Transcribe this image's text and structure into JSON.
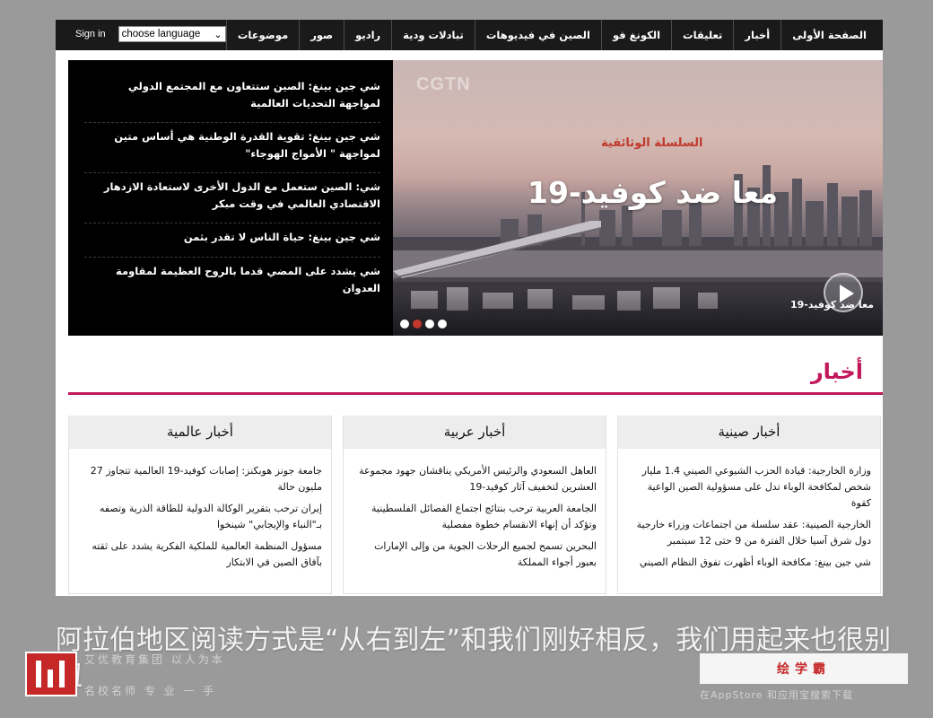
{
  "nav": {
    "items": [
      "الصفحة الأولى",
      "أخبار",
      "تعليقات",
      "الكونغ فو",
      "الصين في فيديوهات",
      "تبادلات ودية",
      "راديو",
      "صور",
      "موضوعات"
    ],
    "signin_label": "Sign in",
    "language_select": "choose language"
  },
  "hero": {
    "headlines": [
      "شي جين بينغ: الصين ستتعاون مع المجتمع الدولي لمواجهة التحديات العالمية",
      "شي جين بينغ: تقوية القدرة الوطنية هي أساس متين لمواجهة \" الأمواج الهوجاء\"",
      "شي: الصين ستعمل مع الدول الأخرى لاستعادة الازدهار الاقتصادي العالمي في وقت مبكر",
      "شي جين بينغ: حياة الناس لا تقدر بثمن",
      "شي يشدد على المضي قدما بالروح العظيمة لمقاومة العدوان"
    ],
    "brand_watermark": "CGTN",
    "series_label": "السلسلة الوثائقية",
    "title": "معا ضد كوفيد-19",
    "caption": "معا ضد كوفيد-19",
    "active_slide": 2,
    "slide_count": 4
  },
  "news": {
    "title": "أخبار",
    "columns": [
      {
        "title": "أخبار صينية",
        "items": [
          "وزارة الخارجية: قيادة الحزب الشيوعي الصيني 1.4 مليار شخص لمكافحة الوباء تدل على مسؤولية الصين الواعية كقوة",
          "الخارجية الصينية: عقد سلسلة من اجتماعات وزراء خارجية دول شرق آسيا خلال الفترة من 9 حتى 12 سبتمبر",
          "شي جين بينغ: مكافحة الوباء أظهرت تفوق النظام الصيني"
        ]
      },
      {
        "title": "أخبار عربية",
        "items": [
          "العاهل السعودي والرئيس الأمريكي يناقشان جهود مجموعة العشرين لتخفيف آثار كوفيد-19",
          "الجامعة العربية ترحب بنتائج اجتماع الفصائل الفلسطينية وتؤكد أن إنهاء الانقسام خطوة مفصلية",
          "البحرين تسمح لجميع الرحلات الجوية من وإلى الإمارات بعبور أجواء المملكة"
        ]
      },
      {
        "title": "أخبار عالمية",
        "items": [
          "جامعة جونز هوبكنز: إصابات كوفيد-19 العالمية تتجاوز 27 مليون حالة",
          "إيران ترحب بتقرير الوكالة الدولية للطاقة الذرية وتصفه بـ\"النباء والإيجابي\" شينخوا",
          "مسؤول المنظمة العالمية للملكية الفكرية يشدد على ثقته بآفاق الصين في الابتكار"
        ]
      }
    ]
  },
  "overlay": {
    "caption": "阿拉伯地区阅读方式是“从右到左”和我们刚好相反，我们用起来也很别扭",
    "watermark_left": "艾优教育集团 以人为本",
    "watermark_left_sub": "名校名师 专 业 一 手",
    "brand": "绘学霸",
    "store_text": "在AppStore 和应用宝搜索下载"
  }
}
